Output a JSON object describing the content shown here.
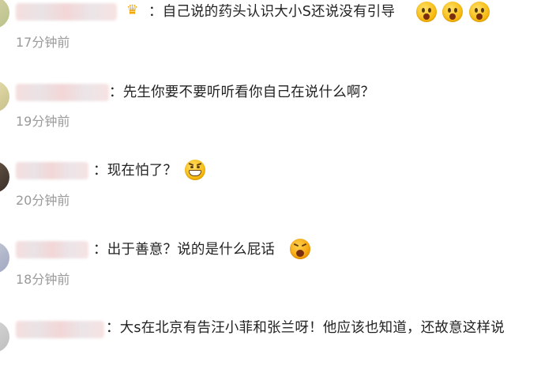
{
  "comments": [
    {
      "user_icon": "crown-icon",
      "text": "：自己说的药头认识大小S还说没有引导",
      "emojis": [
        "shocked-emoji-icon",
        "shocked-emoji-icon",
        "shocked-emoji-icon"
      ],
      "time": "17分钟前"
    },
    {
      "text": "：先生你要不要听听看你自己在说什么啊？",
      "time": "19分钟前"
    },
    {
      "text": "：现在怕了？",
      "emojis": [
        "grimace-emoji-icon"
      ],
      "time": "20分钟前"
    },
    {
      "text": "：出于善意？说的是什么屁话",
      "emojis": [
        "angry-emoji-icon"
      ],
      "time": "18分钟前"
    },
    {
      "text": "：大s在北京有告汪小菲和张兰呀！他应该也知道，还故意这样说"
    }
  ],
  "colors": {
    "text": "#222222",
    "time": "#9a9a9a",
    "emoji": "#f5b400",
    "vip": "#f0a400"
  }
}
